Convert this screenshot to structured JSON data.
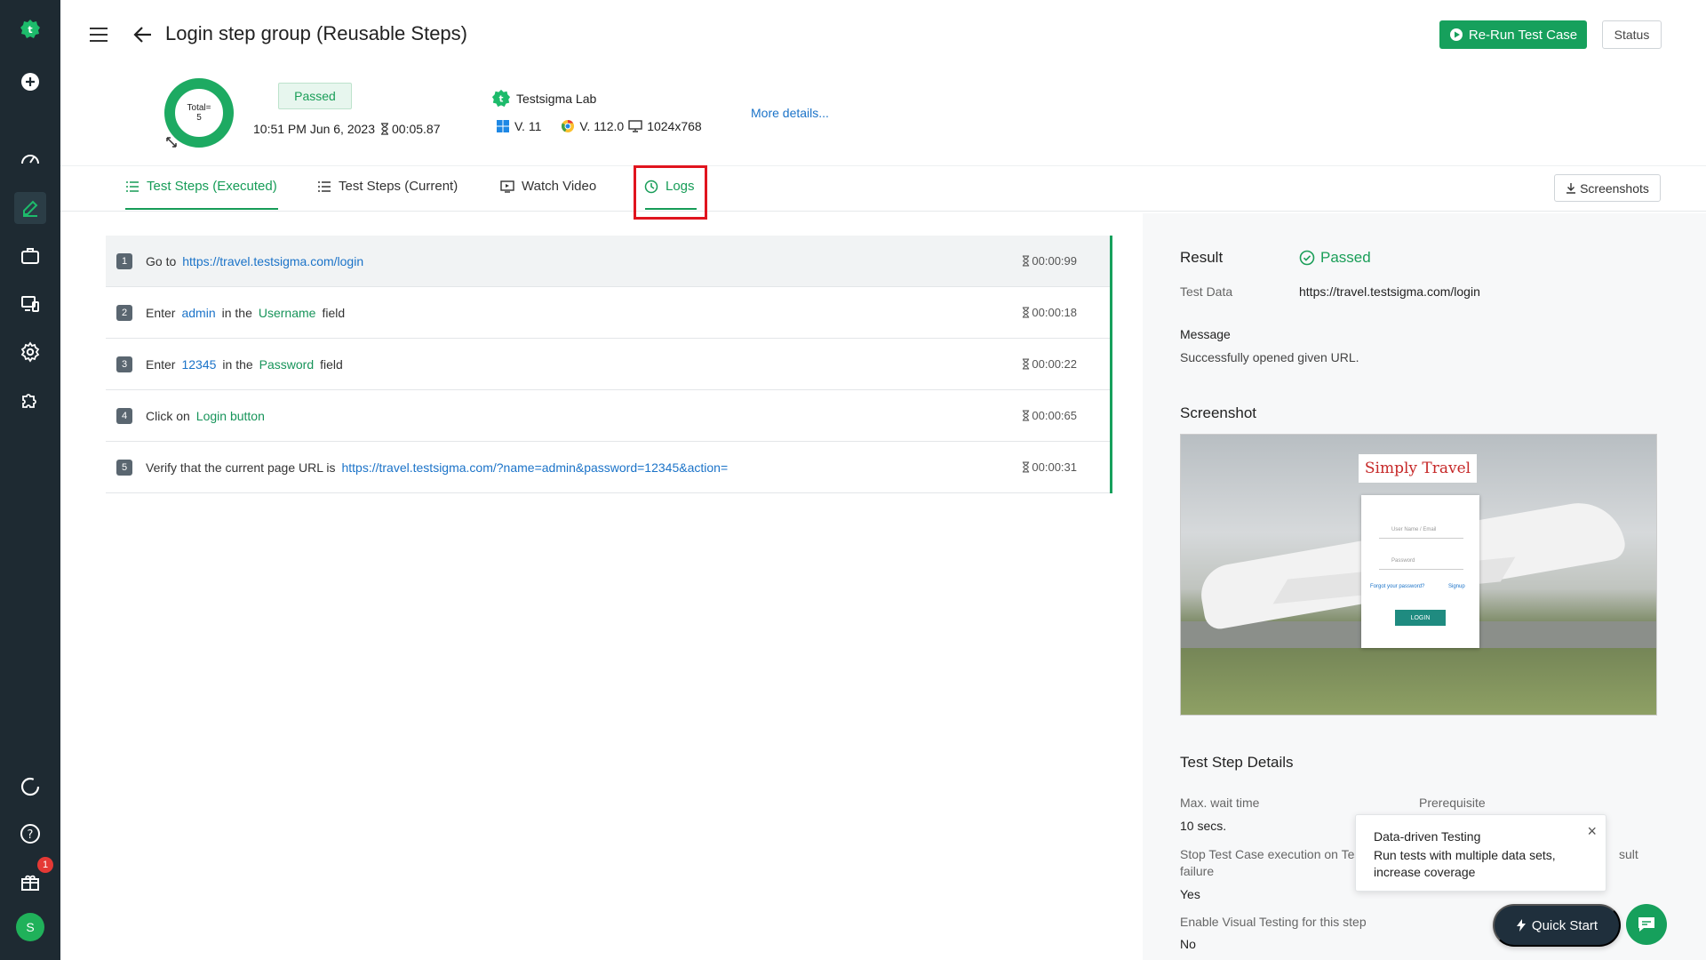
{
  "header": {
    "title": "Login step group (Reusable Steps)",
    "rerun_label": "Re-Run Test Case",
    "status_label": "Status"
  },
  "summary": {
    "total_label": "Total=",
    "total_value": "5",
    "result": "Passed",
    "date": "10:51 PM Jun 6, 2023",
    "duration": "00:05.87",
    "lab": "Testsigma Lab",
    "os_version": "V. 11",
    "browser_version": "V. 112.0",
    "resolution": "1024x768",
    "more_details": "More details..."
  },
  "tabs": [
    {
      "label": "Test Steps (Executed)"
    },
    {
      "label": "Test Steps (Current)"
    },
    {
      "label": "Watch Video"
    },
    {
      "label": "Logs"
    }
  ],
  "screenshots_label": "Screenshots",
  "steps": [
    {
      "num": "1",
      "parts": [
        "Go to",
        "https://travel.testsigma.com/login"
      ],
      "time": "00:00:99"
    },
    {
      "num": "2",
      "parts": [
        "Enter",
        "admin",
        "in the",
        "Username",
        "field"
      ],
      "time": "00:00:18"
    },
    {
      "num": "3",
      "parts": [
        "Enter",
        "12345",
        "in the",
        "Password",
        "field"
      ],
      "time": "00:00:22"
    },
    {
      "num": "4",
      "parts": [
        "Click on",
        "Login button"
      ],
      "time": "00:00:65"
    },
    {
      "num": "5",
      "parts": [
        "Verify that the current page URL is",
        "https://travel.testsigma.com/?name=admin&password=12345&action="
      ],
      "time": "00:00:31"
    }
  ],
  "details": {
    "result_label": "Result",
    "result_value": "Passed",
    "test_data_label": "Test Data",
    "test_data_value": "https://travel.testsigma.com/login",
    "message_label": "Message",
    "message_value": "Successfully opened given URL.",
    "screenshot_label": "Screenshot",
    "screenshot_logo": "Simply Travel",
    "screenshot_user": "User Name / Email",
    "screenshot_pass": "Password",
    "screenshot_forgot": "Forgot your password?",
    "screenshot_signup": "Signup",
    "screenshot_login": "LOGIN",
    "step_details_label": "Test Step Details",
    "max_wait_label": "Max. wait time",
    "max_wait_value": "10 secs.",
    "prereq_label": "Prerequisite",
    "stop_label_1": "Stop Test Case execution on Tes",
    "stop_label_2": "failure",
    "stop_value": "Yes",
    "result_partial": "sult",
    "visual_label": "Enable Visual Testing for this step",
    "visual_value": "No"
  },
  "popup": {
    "title": "Data-driven Testing",
    "body": "Run tests with multiple data sets, increase coverage",
    "close": "×"
  },
  "quick_start_label": "Quick Start",
  "user": {
    "avatar_letter": "S",
    "notifications": "1"
  }
}
